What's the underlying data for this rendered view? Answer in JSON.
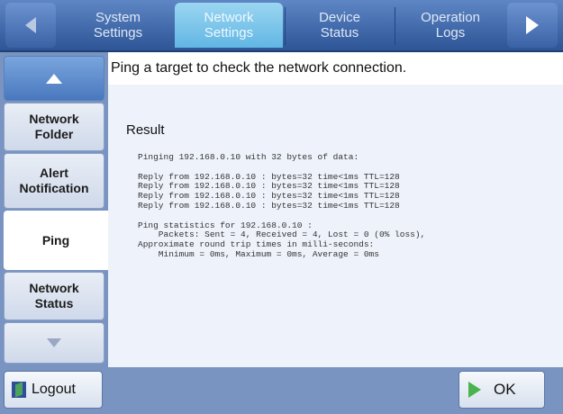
{
  "tabs": [
    {
      "label": "System\nSettings",
      "active": false
    },
    {
      "label": "Network\nSettings",
      "active": true
    },
    {
      "label": "Device\nStatus",
      "active": false
    },
    {
      "label": "Operation\nLogs",
      "active": false
    }
  ],
  "sidebar": {
    "items": [
      {
        "label": "Network\nFolder",
        "active": false
      },
      {
        "label": "Alert\nNotification",
        "active": false
      },
      {
        "label": "Ping",
        "active": true
      },
      {
        "label": "Network\nStatus",
        "active": false
      }
    ]
  },
  "main": {
    "instruction": "Ping a target to check the network connection.",
    "result_title": "Result",
    "result_text": "Pinging 192.168.0.10 with 32 bytes of data:\n\nReply from 192.168.0.10 : bytes=32 time<1ms TTL=128\nReply from 192.168.0.10 : bytes=32 time<1ms TTL=128\nReply from 192.168.0.10 : bytes=32 time<1ms TTL=128\nReply from 192.168.0.10 : bytes=32 time<1ms TTL=128\n\nPing statistics for 192.168.0.10 :\n    Packets: Sent = 4, Received = 4, Lost = 0 (0% loss),\nApproximate round trip times in milli-seconds:\n    Minimum = 0ms, Maximum = 0ms, Average = 0ms"
  },
  "footer": {
    "logout_label": "Logout",
    "ok_label": "OK"
  },
  "colors": {
    "topbar": "#3a62a5",
    "active_tab": "#61b6e4",
    "sidebar": "#7a94c2",
    "ok_icon": "#49b34d"
  },
  "icons": {
    "prev": "chevron-left-icon",
    "next": "chevron-right-icon",
    "scroll_up": "arrow-up-icon",
    "scroll_down": "arrow-down-icon",
    "logout": "logout-icon",
    "ok": "play-icon"
  }
}
